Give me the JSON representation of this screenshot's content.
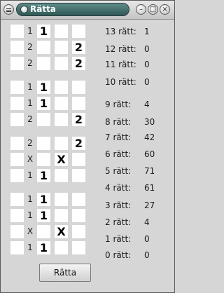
{
  "window": {
    "title": "Rätta",
    "controls": [
      "minimize-icon",
      "maximize-icon",
      "close-icon"
    ]
  },
  "rows": [
    {
      "label": "1",
      "cells": [
        "1",
        "",
        ""
      ]
    },
    {
      "label": "2",
      "cells": [
        "",
        "",
        "2"
      ]
    },
    {
      "label": "2",
      "cells": [
        "",
        "",
        "2"
      ]
    },
    {
      "label": "1",
      "cells": [
        "1",
        "",
        ""
      ]
    },
    {
      "label": "1",
      "cells": [
        "1",
        "",
        ""
      ]
    },
    {
      "label": "2",
      "cells": [
        "",
        "",
        "2"
      ]
    },
    {
      "label": "2",
      "cells": [
        "",
        "",
        "2"
      ]
    },
    {
      "label": "X",
      "cells": [
        "",
        "X",
        ""
      ]
    },
    {
      "label": "1",
      "cells": [
        "1",
        "",
        ""
      ]
    },
    {
      "label": "1",
      "cells": [
        "1",
        "",
        ""
      ]
    },
    {
      "label": "1",
      "cells": [
        "1",
        "",
        ""
      ]
    },
    {
      "label": "X",
      "cells": [
        "",
        "X",
        ""
      ]
    },
    {
      "label": "1",
      "cells": [
        "1",
        "",
        ""
      ]
    }
  ],
  "results": [
    {
      "label": "13 rätt:",
      "value": "1"
    },
    {
      "label": "12 rätt:",
      "value": "0"
    },
    {
      "label": "11 rätt:",
      "value": "0"
    },
    {
      "label": "10 rätt:",
      "value": "0"
    },
    {
      "label": "9 rätt:",
      "value": "4"
    },
    {
      "label": "8 rätt:",
      "value": "30"
    },
    {
      "label": "7 rätt:",
      "value": "42"
    },
    {
      "label": "6 rätt:",
      "value": "60"
    },
    {
      "label": "5 rätt:",
      "value": "71"
    },
    {
      "label": "4 rätt:",
      "value": "61"
    },
    {
      "label": "3 rätt:",
      "value": "27"
    },
    {
      "label": "2 rätt:",
      "value": "4"
    },
    {
      "label": "1 rätt:",
      "value": "0"
    },
    {
      "label": "0 rätt:",
      "value": "0"
    }
  ],
  "button": {
    "label": "Rätta"
  }
}
